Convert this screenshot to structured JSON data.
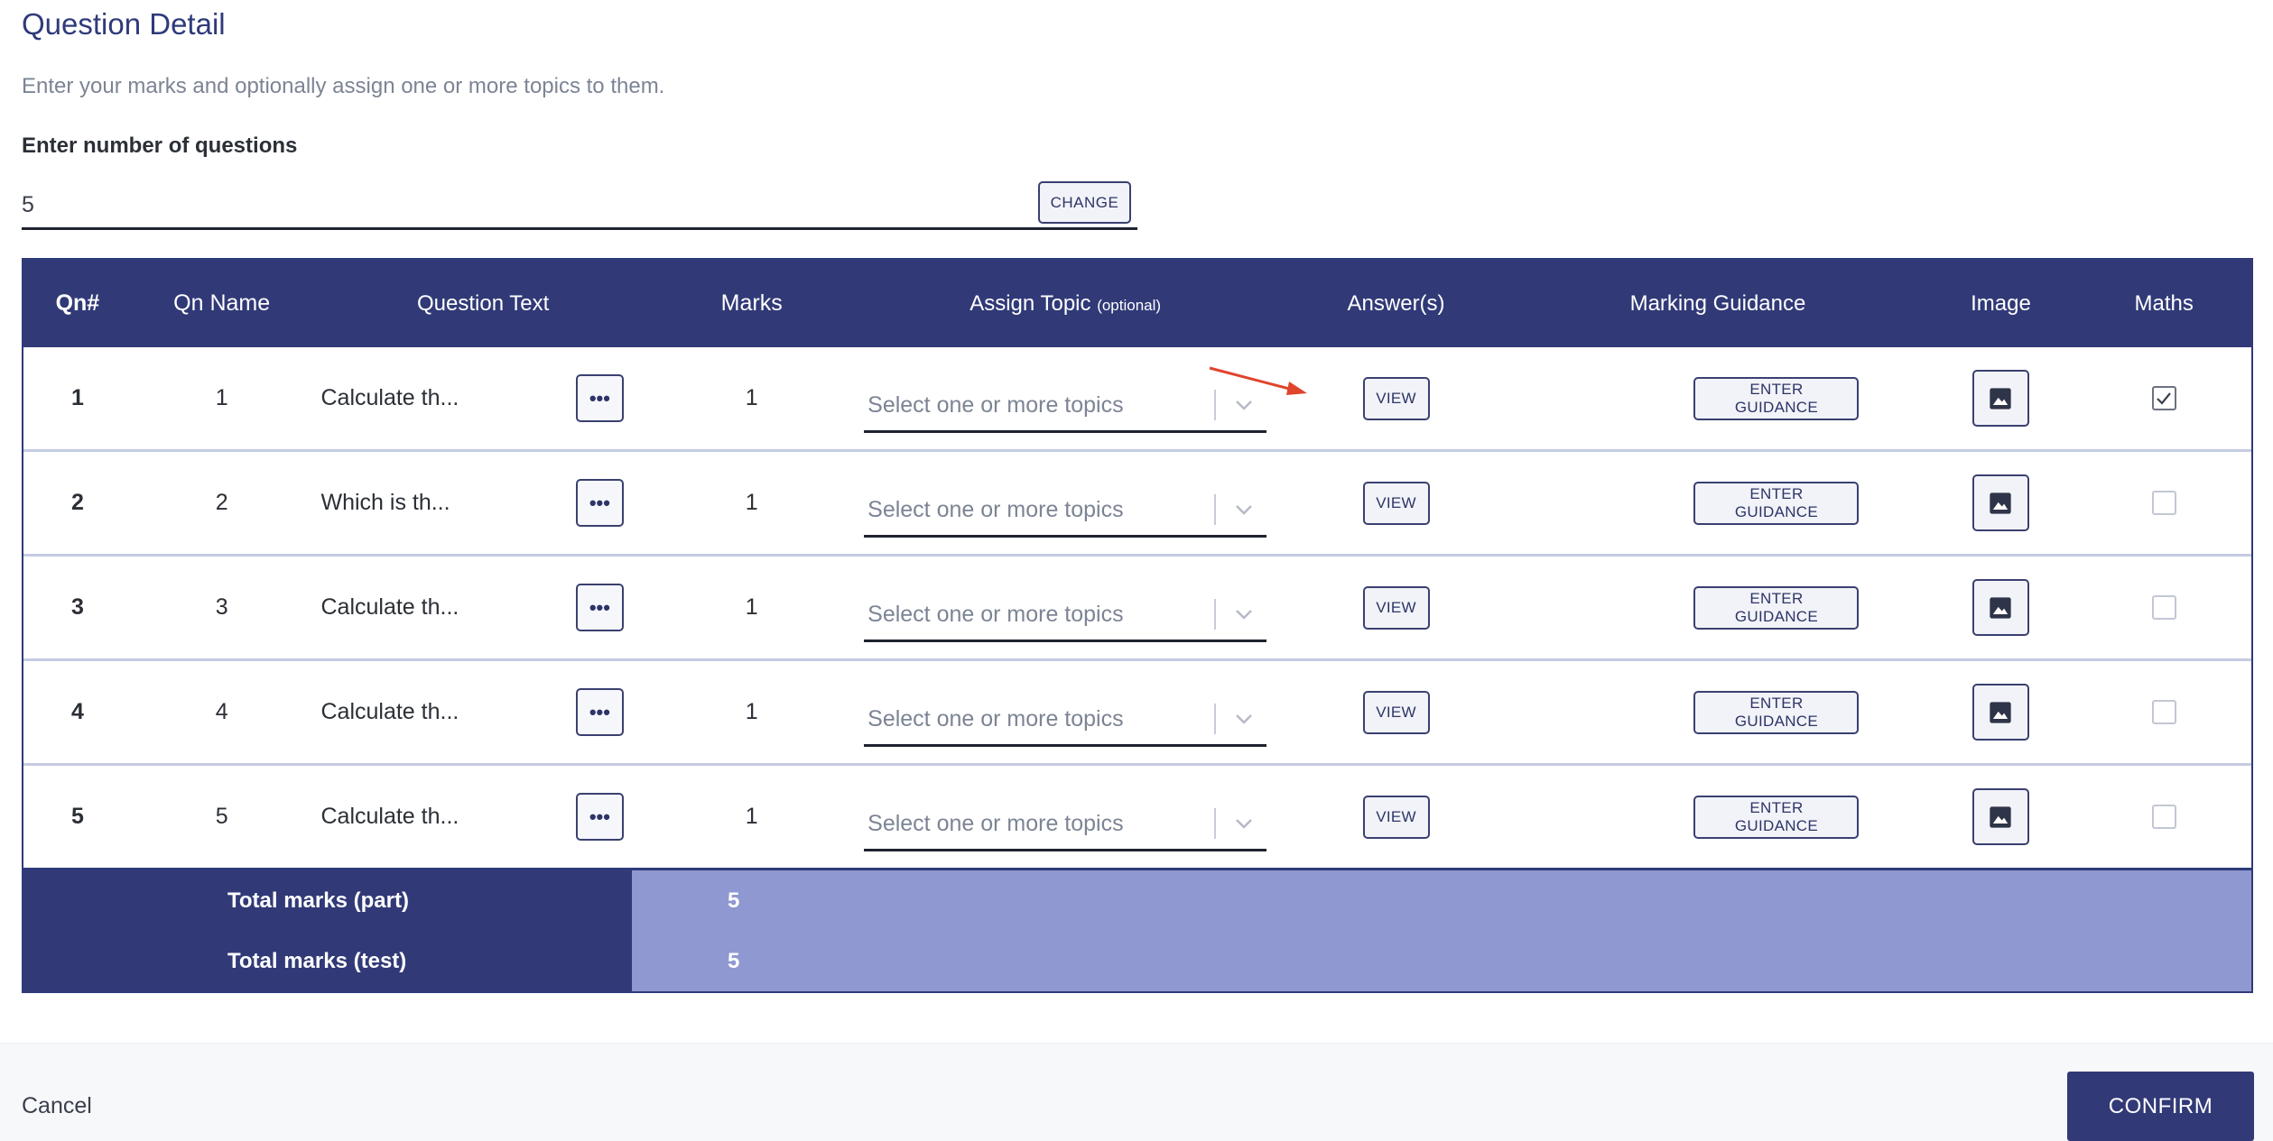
{
  "page": {
    "title": "Question Detail",
    "subtitle": "Enter your marks and optionally assign one or more topics to them.",
    "question_count_label": "Enter number of questions",
    "question_count_value": "5",
    "change_label": "CHANGE"
  },
  "table": {
    "headers": {
      "qn": "Qn#",
      "qn_name": "Qn Name",
      "question_text": "Question Text",
      "marks": "Marks",
      "assign_topic": "Assign Topic",
      "assign_topic_note": "(optional)",
      "answers": "Answer(s)",
      "marking_guidance": "Marking Guidance",
      "image": "Image",
      "maths": "Maths"
    },
    "rows": [
      {
        "qn": "1",
        "name": "1",
        "text": "Calculate th...",
        "marks": "1",
        "topic_placeholder": "Select one or more topics",
        "view_label": "VIEW",
        "guidance_label": "ENTER GUIDANCE",
        "maths": true
      },
      {
        "qn": "2",
        "name": "2",
        "text": "Which is th...",
        "marks": "1",
        "topic_placeholder": "Select one or more topics",
        "view_label": "VIEW",
        "guidance_label": "ENTER GUIDANCE",
        "maths": false
      },
      {
        "qn": "3",
        "name": "3",
        "text": "Calculate th...",
        "marks": "1",
        "topic_placeholder": "Select one or more topics",
        "view_label": "VIEW",
        "guidance_label": "ENTER GUIDANCE",
        "maths": false
      },
      {
        "qn": "4",
        "name": "4",
        "text": "Calculate th...",
        "marks": "1",
        "topic_placeholder": "Select one or more topics",
        "view_label": "VIEW",
        "guidance_label": "ENTER GUIDANCE",
        "maths": false
      },
      {
        "qn": "5",
        "name": "5",
        "text": "Calculate th...",
        "marks": "1",
        "topic_placeholder": "Select one or more topics",
        "view_label": "VIEW",
        "guidance_label": "ENTER GUIDANCE",
        "maths": false
      }
    ],
    "totals": {
      "part_label": "Total marks (part)",
      "part_value": "5",
      "test_label": "Total marks (test)",
      "test_value": "5"
    }
  },
  "footer": {
    "cancel_label": "Cancel",
    "confirm_label": "CONFIRM"
  },
  "icons": {
    "more": "ellipsis-icon",
    "dropdown": "chevron-down-icon",
    "image": "image-icon",
    "check": "checkmark-icon",
    "annotation": "red-arrow-icon"
  },
  "colors": {
    "header_bg": "#313a77",
    "totals_value_bg": "#8f98d0",
    "title": "#2f3a7a",
    "annotation_arrow": "#e0442b"
  }
}
